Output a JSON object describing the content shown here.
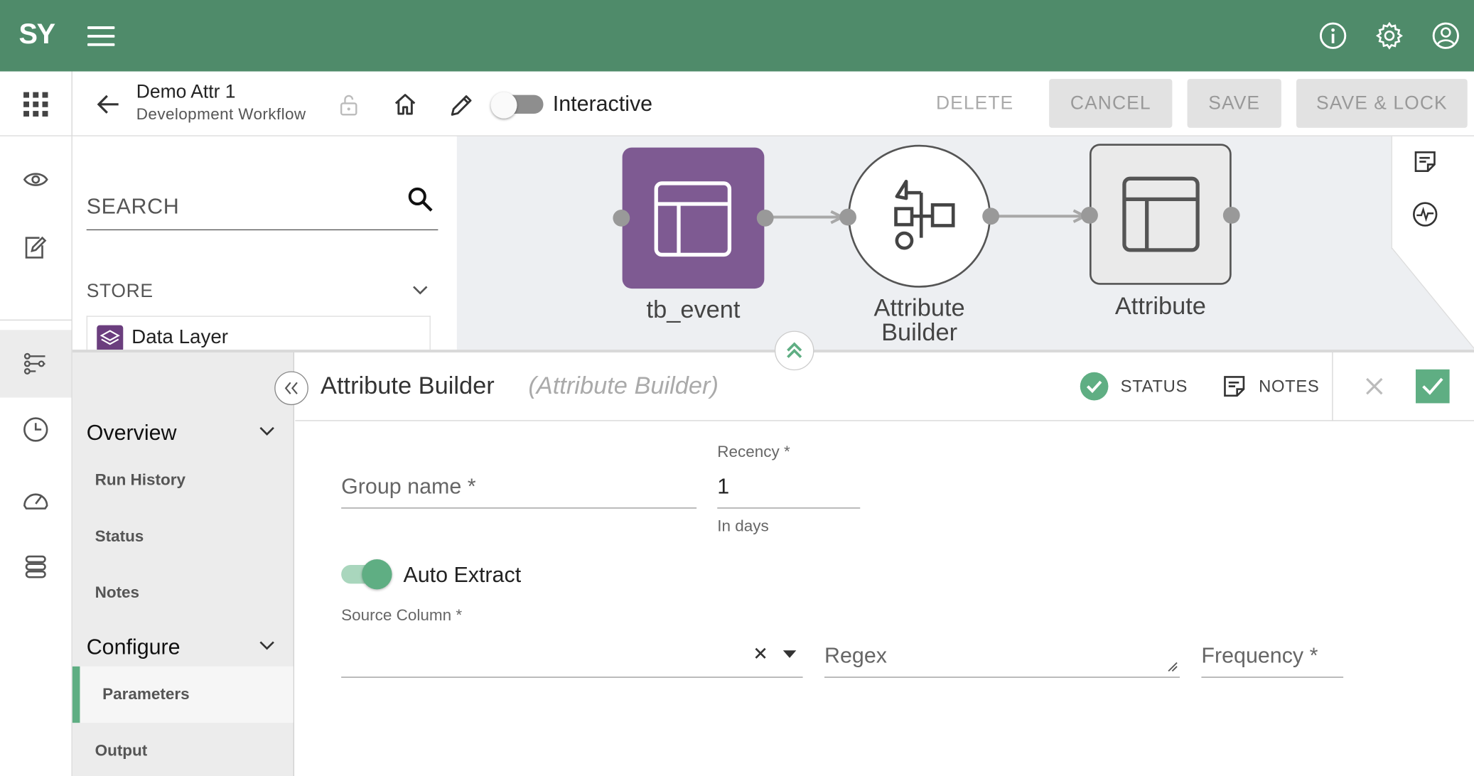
{
  "app": {
    "logo_text": "SY"
  },
  "header": {
    "icons": [
      "info-icon",
      "settings-gear-icon",
      "account-icon"
    ]
  },
  "toolbar": {
    "workflow_title": "Demo Attr 1",
    "workflow_subtitle": "Development Workflow",
    "interactive_label": "Interactive",
    "interactive_on": false,
    "delete_label": "DELETE",
    "cancel_label": "CANCEL",
    "save_label": "SAVE",
    "save_lock_label": "SAVE & LOCK"
  },
  "palette": {
    "search_placeholder": "SEARCH",
    "store_label": "STORE",
    "items": [
      {
        "label": "Data Layer",
        "icon": "layers-icon"
      }
    ]
  },
  "canvas": {
    "nodes": [
      {
        "label": "tb_event",
        "icon": "table-icon",
        "color": "#7e5a92"
      },
      {
        "label": "Attribute Builder",
        "icon": "attribute-builder-icon"
      },
      {
        "label": "Attribute",
        "icon": "table-icon"
      }
    ]
  },
  "panel": {
    "title": "Attribute Builder",
    "subtitle": "(Attribute Builder)",
    "status_label": "STATUS",
    "notes_label": "NOTES",
    "nav": {
      "overview_label": "Overview",
      "overview_items": [
        "Run History",
        "Status",
        "Notes"
      ],
      "configure_label": "Configure",
      "configure_items": [
        "Parameters",
        "Output"
      ]
    },
    "form": {
      "group_name_placeholder": "Group name *",
      "recency_label": "Recency *",
      "recency_value": "1",
      "recency_hint": "In days",
      "auto_extract_label": "Auto Extract",
      "auto_extract_on": true,
      "source_column_label": "Source Column *",
      "source_column_value": "",
      "regex_placeholder": "Regex",
      "frequency_placeholder": "Frequency *"
    }
  },
  "colors": {
    "brand_green": "#4f8b6a",
    "accent_green": "#5fae83",
    "node_purple": "#7e5a92"
  }
}
